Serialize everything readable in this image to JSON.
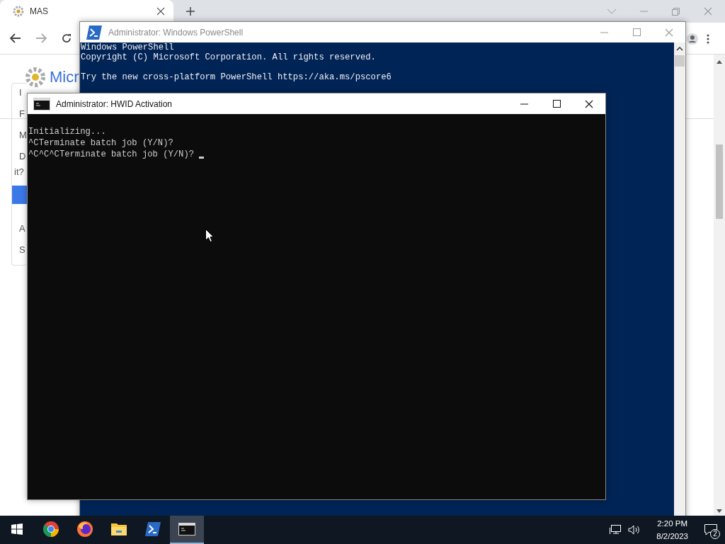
{
  "browser": {
    "tab": {
      "title": "MAS"
    },
    "logo_text": "Micr",
    "menu_items": [
      {
        "label": "I",
        "selected": false
      },
      {
        "label": "F",
        "selected": false
      },
      {
        "label": "M",
        "selected": false
      },
      {
        "label": "D",
        "selected": false
      },
      {
        "label": "it?",
        "selected": false
      },
      {
        "selected": true
      },
      {
        "label": "A",
        "selected": false
      },
      {
        "label": "S",
        "selected": false
      }
    ]
  },
  "powershell": {
    "title": "Administrator: Windows PowerShell",
    "paragraphs": [
      [
        "Windows PowerShell",
        "Copyright (C) Microsoft Corporation. All rights reserved."
      ],
      [
        "Try the new cross-platform PowerShell https://aka.ms/pscore6"
      ]
    ]
  },
  "cmd": {
    "title": "Administrator:  HWID Activation",
    "lines": [
      "Initializing...",
      "^CTerminate batch job (Y/N)?",
      "^C^C^CTerminate batch job (Y/N)? "
    ]
  },
  "taskbar": {
    "apps": [
      {
        "kind": "chrome",
        "selected": false
      },
      {
        "kind": "firefox",
        "selected": false
      },
      {
        "kind": "explorer",
        "selected": false
      },
      {
        "kind": "powershell",
        "selected": false
      },
      {
        "kind": "cmd",
        "selected": true
      }
    ],
    "time": "2:20 PM",
    "date": "8/2/2023",
    "notifications": "2"
  }
}
